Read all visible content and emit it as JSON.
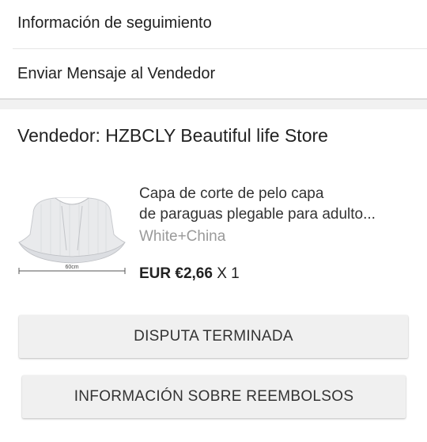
{
  "menu": {
    "tracking_label": "Información de seguimiento",
    "message_label": "Enviar Mensaje al Vendedor"
  },
  "seller": {
    "label": "Vendedor: HZBCLY Beautiful life Store"
  },
  "product": {
    "title_line1": "Capa de corte de pelo capa",
    "title_line2": "de paraguas plegable para adulto...",
    "variant": "White+China",
    "price": "EUR €2,66",
    "quantity": " X 1",
    "image_dimension_label": "60cm",
    "image_icon": "haircut-cape-image"
  },
  "actions": {
    "dispute_label": "DISPUTA TERMINADA",
    "refund_label": "INFORMACIÓN SOBRE REEMBOLSOS"
  },
  "colors": {
    "text": "#222222",
    "muted": "#9a9a9a",
    "button_bg": "#f0f0f0",
    "divider": "#e6e6e6"
  }
}
